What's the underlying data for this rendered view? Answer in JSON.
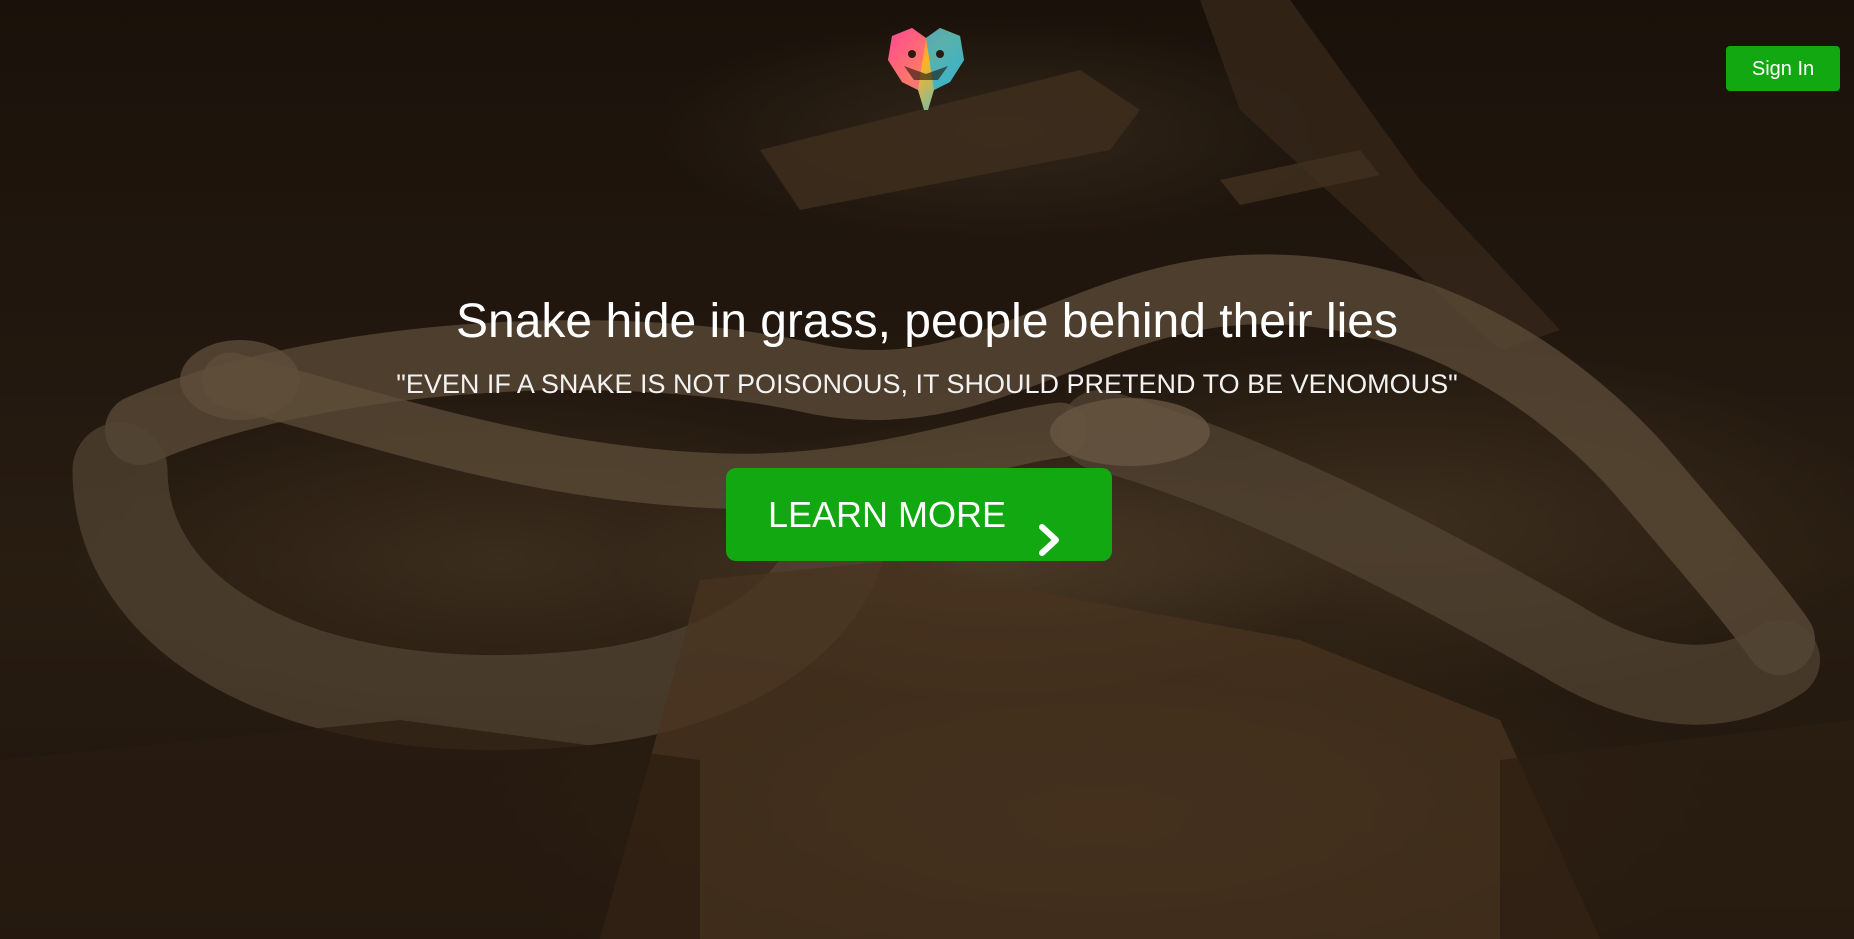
{
  "header": {
    "logo_icon": "snake-head-logo-icon",
    "sign_in_label": "Sign In"
  },
  "hero": {
    "headline": "Snake hide in grass, people behind their lies",
    "quote": "\"EVEN IF A SNAKE IS NOT POISONOUS, IT SHOULD PRETEND TO BE VENOMOUS\"",
    "cta_label": "LEARN MORE",
    "cta_icon": "chevron-right-icon",
    "background": "snake-photo-background"
  },
  "colors": {
    "accent": "#12a812",
    "text": "#ffffff"
  }
}
